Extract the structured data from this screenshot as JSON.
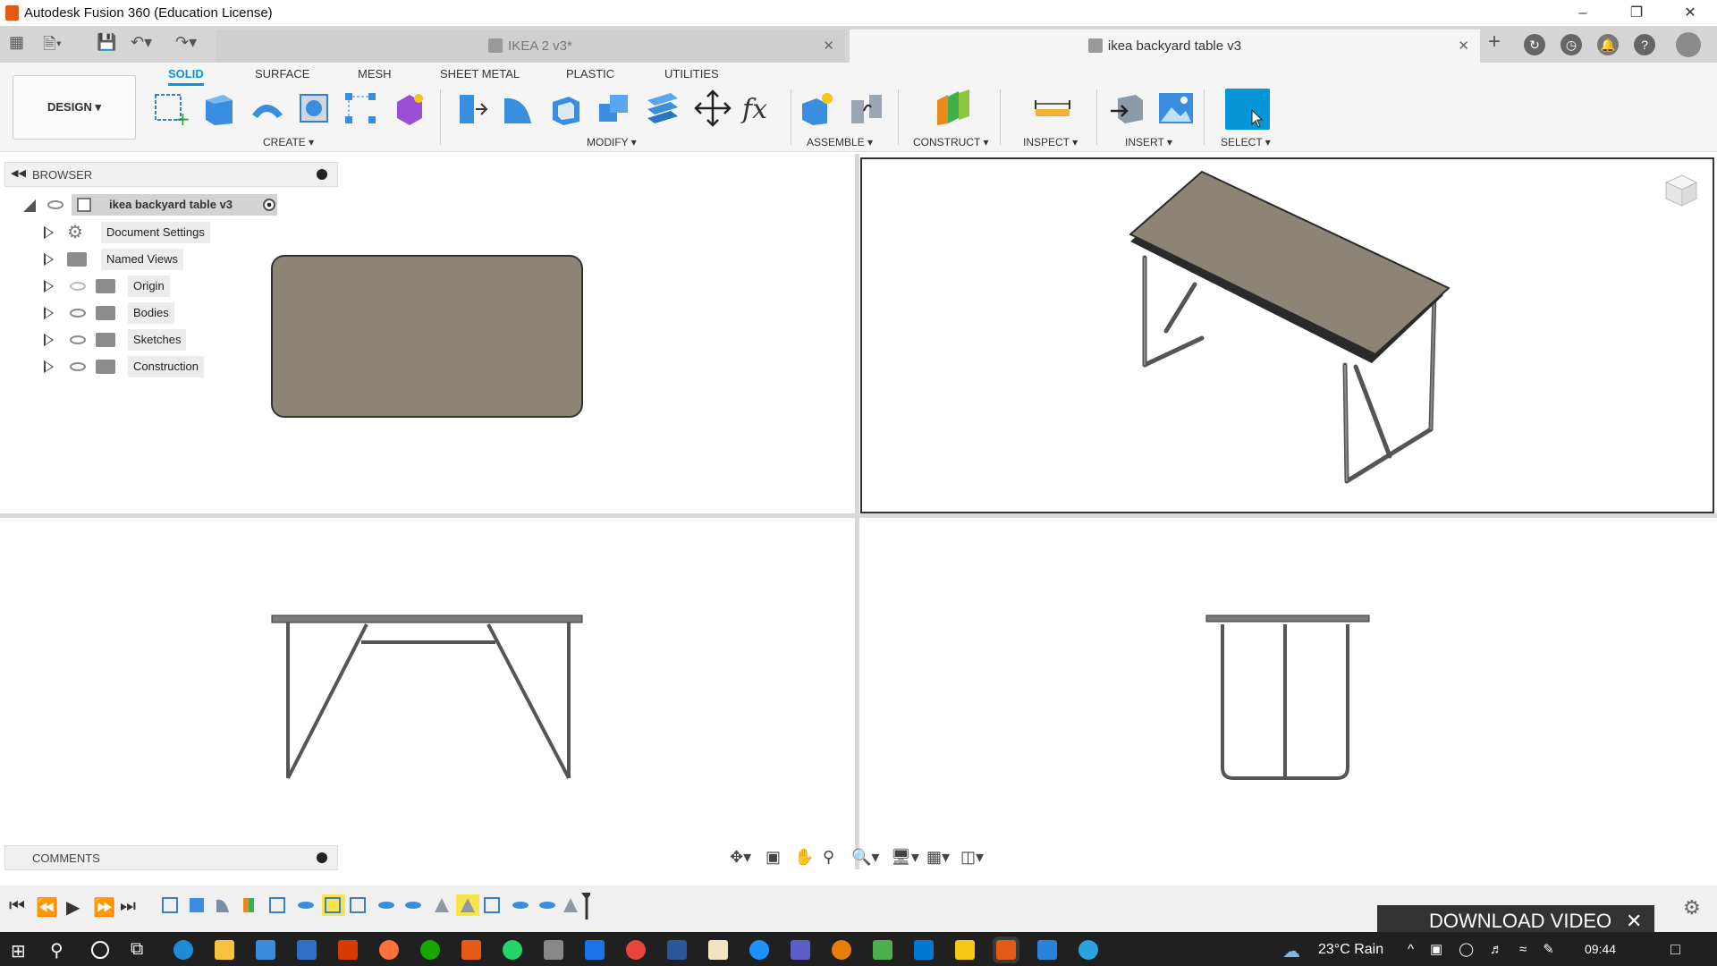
{
  "titlebar": {
    "title": "Autodesk Fusion 360 (Education License)"
  },
  "tabs": [
    {
      "label": "IKEA 2 v3*",
      "active": false
    },
    {
      "label": "ikea backyard table v3",
      "active": true
    }
  ],
  "ribbon": {
    "workspace": "DESIGN",
    "tabs": [
      "SOLID",
      "SURFACE",
      "MESH",
      "SHEET METAL",
      "PLASTIC",
      "UTILITIES"
    ],
    "groups": [
      "CREATE",
      "MODIFY",
      "ASSEMBLE",
      "CONSTRUCT",
      "INSPECT",
      "INSERT",
      "SELECT"
    ]
  },
  "browser": {
    "title": "BROWSER",
    "root": "ikea backyard table v3",
    "items": [
      "Document Settings",
      "Named Views",
      "Origin",
      "Bodies",
      "Sketches",
      "Construction"
    ]
  },
  "comments": {
    "title": "COMMENTS"
  },
  "download": {
    "label": "DOWNLOAD VIDEO"
  },
  "taskbar": {
    "weather": "23°C  Rain",
    "time": "09:44"
  },
  "colors": {
    "accent": "#0696d7",
    "tabletop": "#8c8576",
    "legs": "#6c6c6c"
  }
}
